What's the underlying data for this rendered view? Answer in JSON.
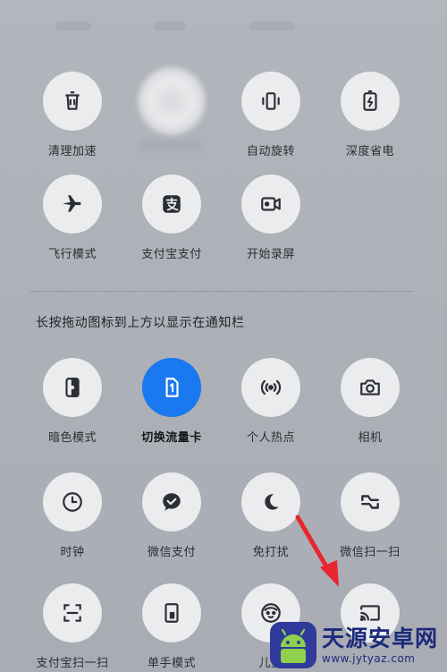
{
  "row1": [
    {
      "label": "清理加速",
      "icon": "trash-icon"
    },
    {
      "label": "",
      "icon": "blurred-icon"
    },
    {
      "label": "自动旋转",
      "icon": "rotate-icon"
    },
    {
      "label": "深度省电",
      "icon": "battery-icon"
    }
  ],
  "row2": [
    {
      "label": "飞行模式",
      "icon": "airplane-icon"
    },
    {
      "label": "支付宝支付",
      "icon": "alipay-icon"
    },
    {
      "label": "开始录屏",
      "icon": "video-icon"
    }
  ],
  "hint": "长按拖动图标到上方以显示在通知栏",
  "row3": [
    {
      "label": "暗色模式",
      "icon": "dark-mode-icon"
    },
    {
      "label": "切换流量卡",
      "icon": "sim-card-icon",
      "active": true
    },
    {
      "label": "个人热点",
      "icon": "hotspot-icon"
    },
    {
      "label": "相机",
      "icon": "camera-icon"
    }
  ],
  "row4": [
    {
      "label": "时钟",
      "icon": "clock-icon"
    },
    {
      "label": "微信支付",
      "icon": "wechat-pay-icon"
    },
    {
      "label": "免打扰",
      "icon": "moon-icon"
    },
    {
      "label": "微信扫一扫",
      "icon": "wechat-scan-icon"
    }
  ],
  "row5": [
    {
      "label": "支付宝扫一扫",
      "icon": "alipay-scan-icon"
    },
    {
      "label": "单手模式",
      "icon": "one-hand-icon"
    },
    {
      "label": "儿童",
      "icon": "kid-icon"
    },
    {
      "label": "",
      "icon": "cast-icon"
    }
  ],
  "watermark": {
    "title": "天源安卓网",
    "url": "www.jytyaz.com"
  },
  "colors": {
    "accent": "#1a78f0",
    "arrow": "#e8262e",
    "background": "#aeb1b8",
    "tile": "#ebecee"
  }
}
